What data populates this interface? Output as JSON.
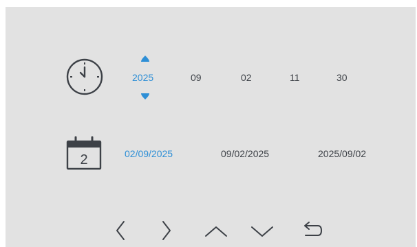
{
  "time": {
    "year": "2025",
    "month": "09",
    "day": "02",
    "hour": "11",
    "minute": "30"
  },
  "calendar_icon_day": "2",
  "date_formats": [
    "02/09/2025",
    "09/02/2025",
    "2025/09/02"
  ],
  "colors": {
    "panel_bg": "#e2e2e2",
    "accent": "#2e8fd6",
    "text": "#3d4147"
  },
  "nav": [
    "chevron-left-icon",
    "chevron-right-icon",
    "chevron-up-icon",
    "chevron-down-icon",
    "back-icon"
  ]
}
